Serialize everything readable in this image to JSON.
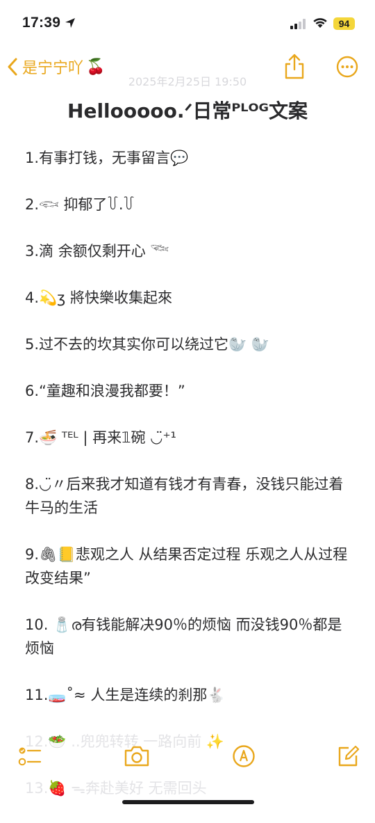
{
  "status": {
    "time": "17:39",
    "battery": "94"
  },
  "nav": {
    "back_label": "是宁宁吖",
    "back_emoji": "🍒"
  },
  "note": {
    "date": "2025年2月25日 19:50",
    "title": "Hellooooo.ᐟ日常ᴾᴸᴼᴳ文案",
    "lines": [
      "1.有事打钱，无事留言💬",
      "2.𓆟 抑郁了꒦.꒦",
      "3.滴 余额仅剩开心 𓆝",
      "4.💫ʒ 將快樂收集起來",
      "5.过不去的坎其实你可以绕过它🦭 🦭",
      "6.“童趣和浪漫我都要！”",
      "7.🍜 ᵀᴱᴸ | 再来𝟙碗 ◡̈⁺¹",
      "8.◡̈〃后来我才知道有钱才有青春，没钱只能过着牛马的生活",
      "9.🖇📒悲观之人 从结果否定过程 乐观之人从过程改变结果”",
      "10. 🧂ര有钱能解决90％的烦恼 而没钱90％都是烦恼",
      "11.🧫˚≈ 人生是连续的刹那🐇",
      "12.🥗 ..兜兜转转 一路向前 ✨",
      "13.🍓 ᯓ奔赴美好 无需回头"
    ]
  },
  "toolbar": {
    "checklist": "checklist-icon",
    "camera": "camera-icon",
    "markup": "markup-pen-icon",
    "compose": "compose-icon"
  },
  "colors": {
    "accent": "#e9a71c",
    "text": "#2b2b2d",
    "faded": "#e3e3e6",
    "battery": "#f4d63a"
  }
}
